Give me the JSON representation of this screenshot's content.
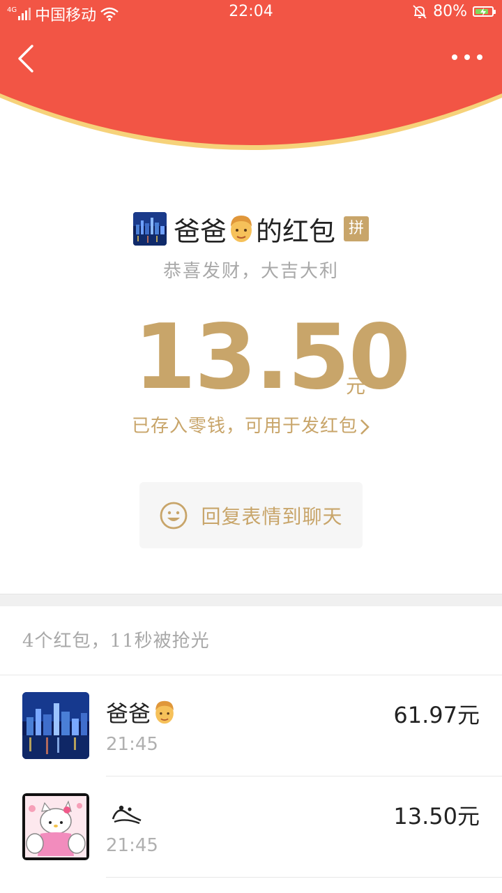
{
  "status_bar": {
    "network_type": "4G",
    "carrier": "中国移动",
    "time": "22:04",
    "battery": "80%",
    "battery_level": 0.8
  },
  "header": {
    "back_icon": "chevron-left-icon",
    "more_icon": "more-dots-icon",
    "accent_color": "#f25545",
    "gold_color": "#c8a56a"
  },
  "envelope": {
    "sender_name_prefix": "爸爸",
    "sender_name_suffix": "的红包",
    "badge": "拼",
    "blessing": "恭喜发财，大吉大利",
    "amount": "13.50",
    "unit": "元",
    "saved_text": "已存入零钱，可用于发红包",
    "reply_label": "回复表情到聊天"
  },
  "list": {
    "summary": "4个红包，11秒被抢光",
    "items": [
      {
        "name": "爸爸",
        "time": "21:45",
        "amount": "61.97元"
      },
      {
        "name": "",
        "time": "21:45",
        "amount": "13.50元"
      }
    ]
  }
}
